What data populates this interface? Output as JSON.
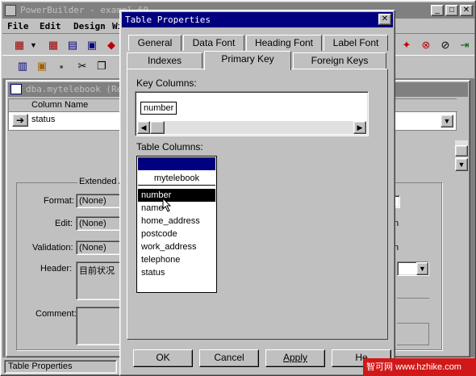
{
  "app": {
    "title": "PowerBuilder - exampl 60",
    "menu": [
      "File",
      "Edit",
      "Design",
      "Wi"
    ],
    "statusbar": "Table Properties"
  },
  "painter": {
    "title": "dba.mytelebook  (Re",
    "column_header": "Column Name",
    "row_value": "status",
    "extended_label": "Extended A",
    "labels": {
      "format": "Format:",
      "edit": "Edit:",
      "validation": "Validation:",
      "header": "Header:",
      "comment": "Comment:"
    },
    "format_value": "(None)",
    "edit_value": "(None)",
    "validation_value": "(None)",
    "header_value": "目前状况",
    "right_letters": [
      "n",
      "n"
    ]
  },
  "dialog": {
    "title": "Table Properties",
    "tabs_row1": [
      "General",
      "Data Font",
      "Heading Font",
      "Label Font"
    ],
    "tabs_row2": [
      "Indexes",
      "Primary Key",
      "Foreign Keys"
    ],
    "key_columns_label": "Key Columns:",
    "key_columns": [
      "number"
    ],
    "table_columns_label": "Table Columns:",
    "table_name": "mytelebook",
    "table_columns": [
      "number",
      "name",
      "home_address",
      "postcode",
      "work_address",
      "telephone",
      "status"
    ],
    "selected_column": "number",
    "buttons": {
      "ok": "OK",
      "cancel": "Cancel",
      "apply": "Apply",
      "help": "He"
    }
  },
  "watermark": "智可网 www.hzhike.com"
}
